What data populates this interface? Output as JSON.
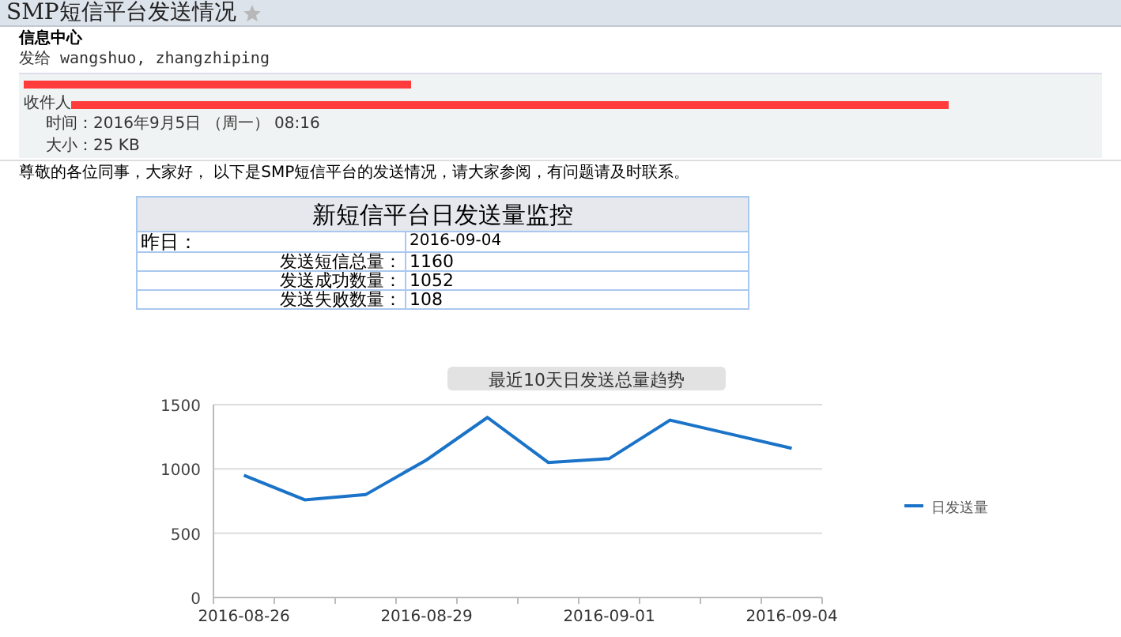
{
  "mail": {
    "subject": "SMP短信平台发送情况",
    "starred": false,
    "sender": "信息中心",
    "to_line": "发给 wangshuo, zhangzhiping",
    "recipient_label": "收件人",
    "time": "时间：2016年9月5日 （周一） 08:16",
    "size": "大小：25 KB"
  },
  "body": {
    "greeting": "尊敬的各位同事，大家好， 以下是SMP短信平台的发送情况，请大家参阅，有问题请及时联系。"
  },
  "report": {
    "title": "新短信平台日发送量监控",
    "date_label": "昨日：",
    "date": "2016-09-04",
    "rows": [
      {
        "label": "发送短信总量：",
        "value": "1160"
      },
      {
        "label": "发送成功数量：",
        "value": "1052"
      },
      {
        "label": "发送失败数量：",
        "value": "108"
      }
    ]
  },
  "chart": {
    "chart_data": {
      "type": "line",
      "title": "最近10天日发送总量趋势",
      "categories": [
        "2016-08-26",
        null,
        null,
        "2016-08-29",
        null,
        null,
        "2016-09-01",
        null,
        null,
        "2016-09-04"
      ],
      "ylim": [
        0,
        1500
      ],
      "yticks": [
        {
          "value": 0,
          "label": "0"
        },
        {
          "value": 500,
          "label": "500"
        },
        {
          "value": 1000,
          "label": "1000"
        },
        {
          "value": 1500,
          "label": "1500"
        }
      ],
      "series": [
        {
          "name": "日发送量",
          "color": "#1a73c8",
          "values": [
            950,
            760,
            800,
            1070,
            1400,
            1050,
            1080,
            1380,
            1270,
            1160
          ]
        }
      ]
    }
  }
}
